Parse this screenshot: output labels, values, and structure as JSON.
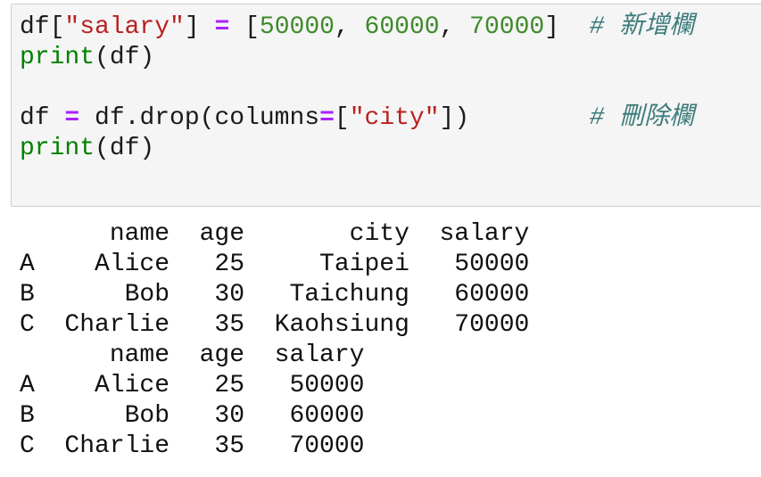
{
  "code": {
    "line1": {
      "var": "df",
      "open_bracket": "[",
      "key": "\"salary\"",
      "close_bracket": "]",
      "assign": "=",
      "list_open": "[",
      "n1": "50000",
      "n2": "60000",
      "n3": "70000",
      "list_close": "]",
      "comment": "# 新增欄"
    },
    "line2": {
      "fn": "print",
      "args": "(df)"
    },
    "line4": {
      "var": "df",
      "assign": "=",
      "call": "df.drop(columns",
      "eq": "=",
      "list_open": "[",
      "str": "\"city\"",
      "close": "])",
      "comment": "# 刪除欄"
    },
    "line5": {
      "fn": "print",
      "args": "(df)"
    }
  },
  "output": {
    "table1": {
      "header": "      name  age       city  salary",
      "rows": [
        "A    Alice   25     Taipei   50000",
        "B      Bob   30   Taichung   60000",
        "C  Charlie   35  Kaohsiung   70000"
      ]
    },
    "table2": {
      "header": "      name  age  salary",
      "rows": [
        "A    Alice   25   50000",
        "B      Bob   30   60000",
        "C  Charlie   35   70000"
      ]
    }
  },
  "colors": {
    "string": "#ba2121",
    "number": "#3f8a2b",
    "operator": "#aa22ff",
    "builtin": "#008000",
    "comment": "#3d7b7b",
    "cell_background": "#f5f5f5"
  }
}
